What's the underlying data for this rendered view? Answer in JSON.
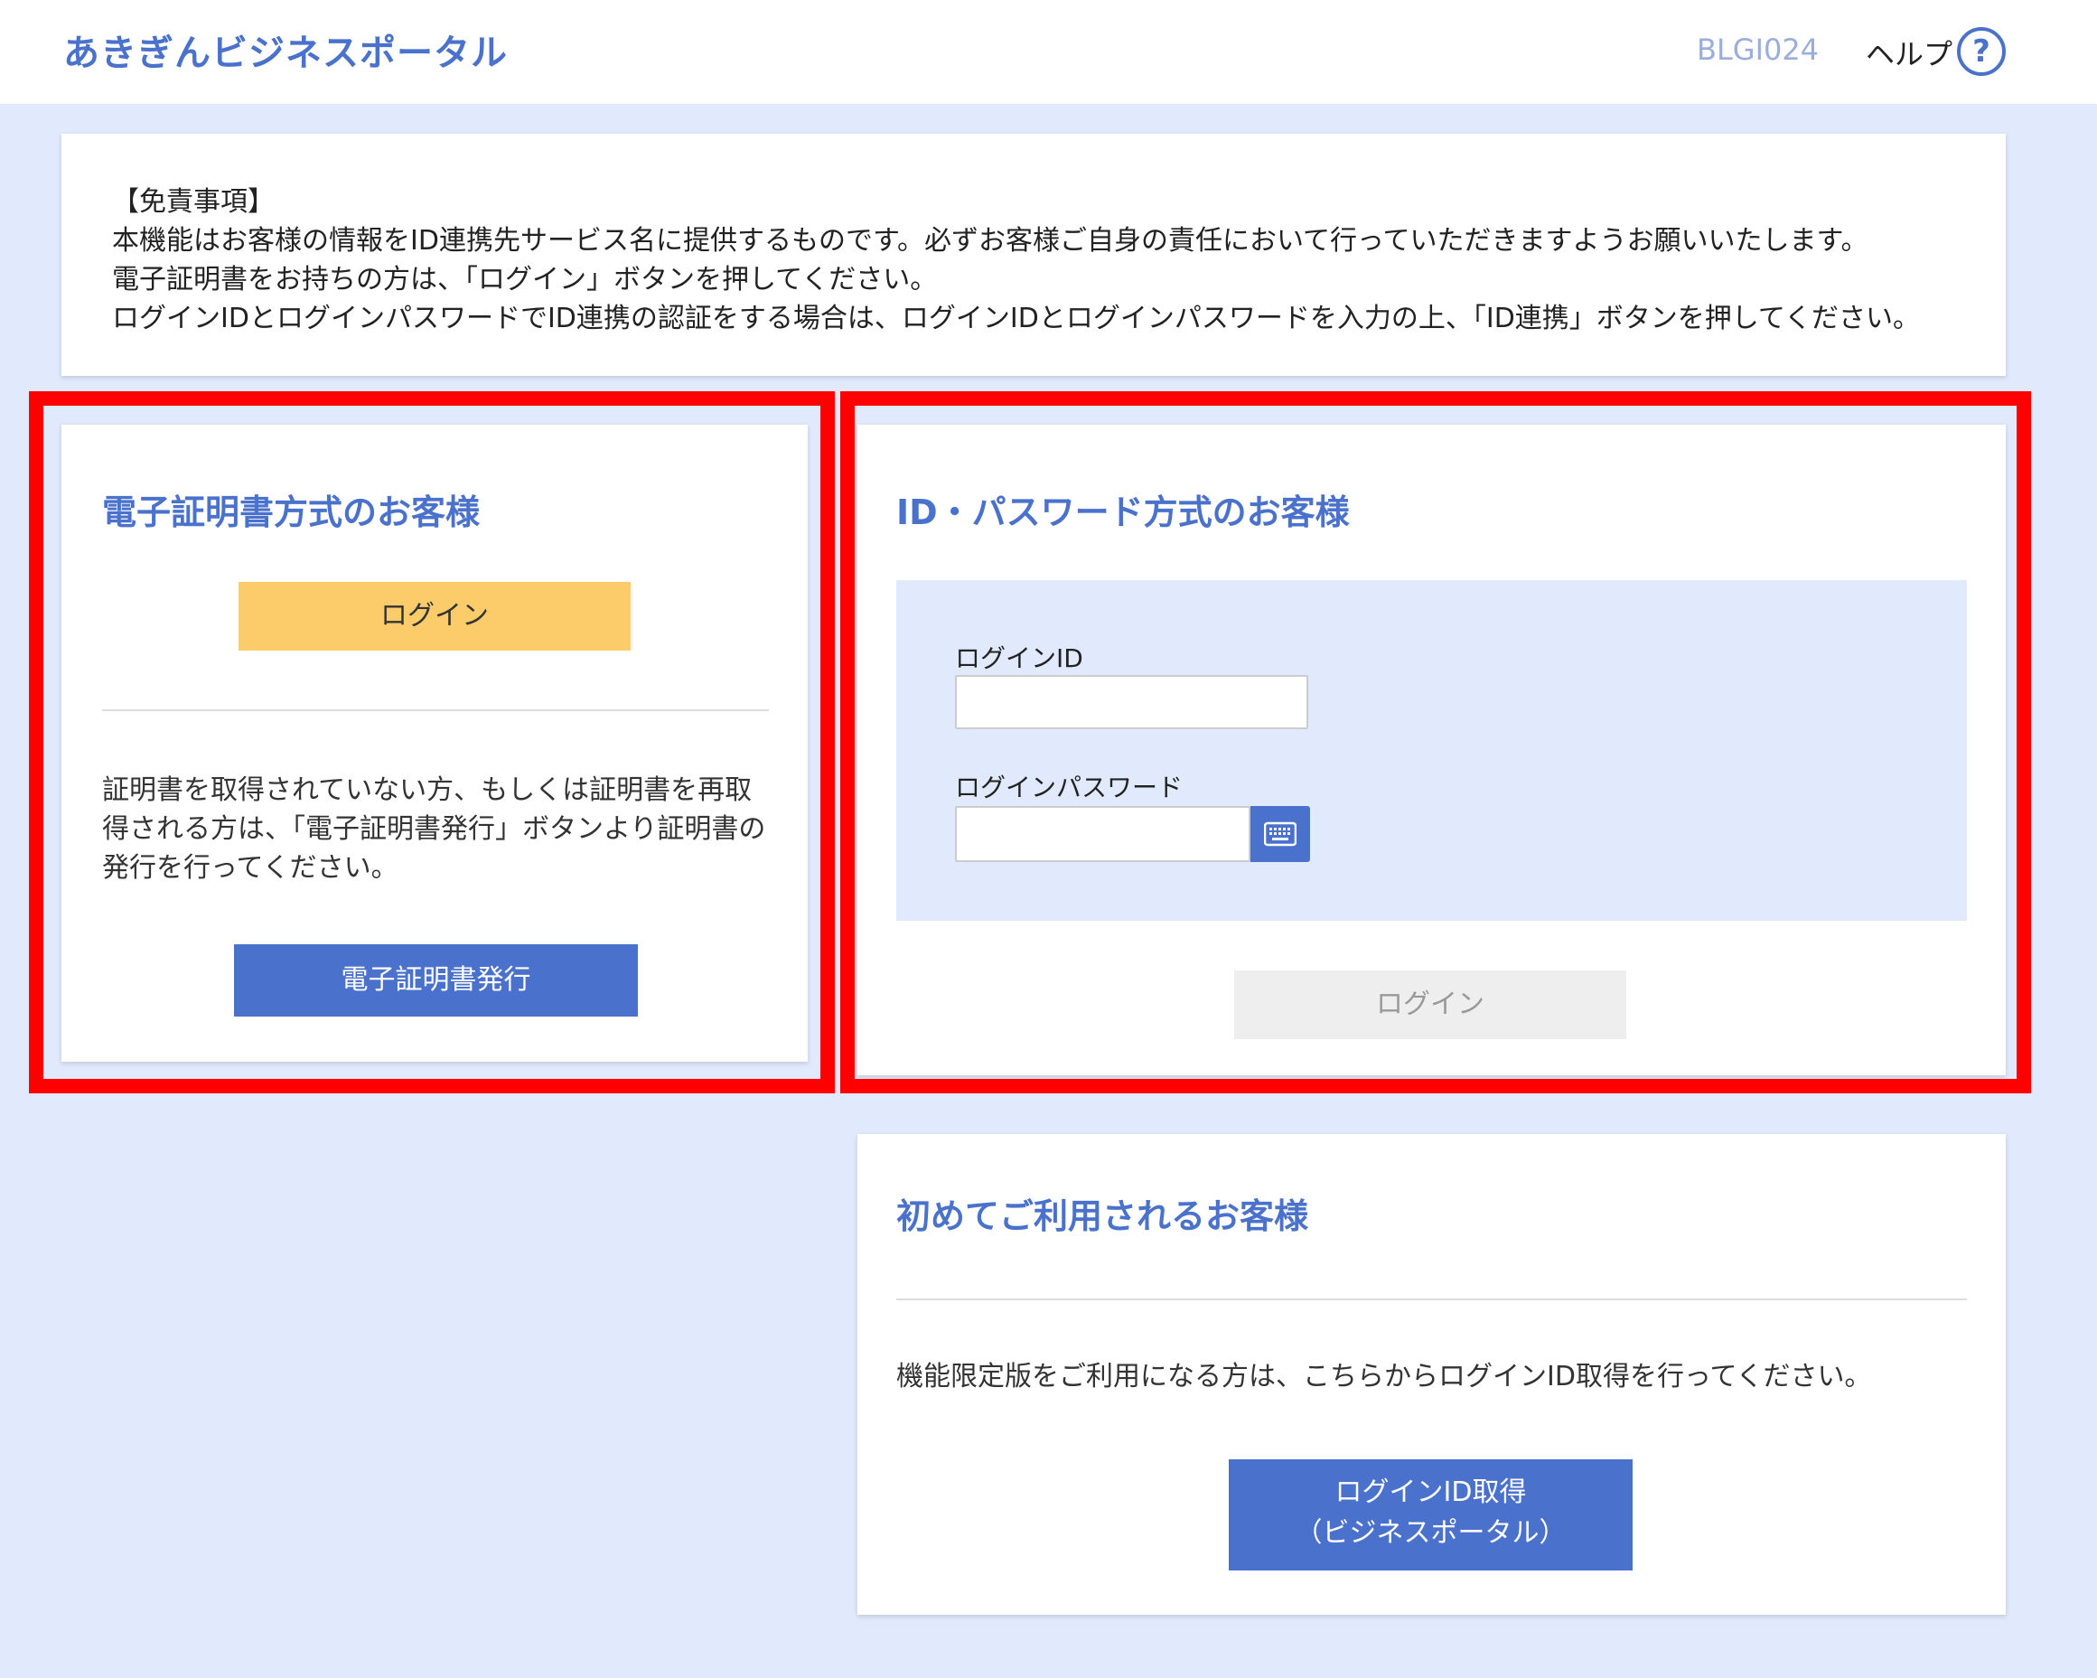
{
  "header": {
    "title": "あきぎんビジネスポータル",
    "screen_id": "BLGI024",
    "help_label": "ヘルプ",
    "help_icon_glyph": "?"
  },
  "disclaimer": {
    "lines": [
      "【免責事項】",
      " 本機能はお客様の情報をID連携先サービス名に提供するものです。必ずお客様ご自身の責任において行っていただきますようお願いいたします。",
      "電子証明書をお持ちの方は、「ログイン」ボタンを押してください。",
      "ログインIDとログインパスワードでID連携の認証をする場合は、ログインIDとログインパスワードを入力の上、「ID連携」ボタンを押してください。"
    ]
  },
  "cert_panel": {
    "title": "電子証明書方式のお客様",
    "login_button": "ログイン",
    "description": "証明書を取得されていない方、もしくは証明書を再取得される方は、「電子証明書発行」ボタンより証明書の発行を行ってください。",
    "issue_button": "電子証明書発行"
  },
  "id_panel": {
    "title": "ID・パスワード方式のお客様",
    "login_id_label": "ログインID",
    "login_id_value": "",
    "password_label": "ログインパスワード",
    "password_value": "",
    "keyboard_icon": "keyboard-icon",
    "login_button": "ログイン"
  },
  "first_panel": {
    "title": "初めてご利用されるお客様",
    "description": "機能限定版をご利用になる方は、こちらからログインID取得を行ってください。",
    "acquire_button_line1": "ログインID取得",
    "acquire_button_line2": "（ビジネスポータル）"
  },
  "colors": {
    "accent": "#4a72cc",
    "background": "#e0eafc",
    "highlight": "#ff0000",
    "login_button": "#fccb6a",
    "disabled_button": "#eeeeee"
  }
}
